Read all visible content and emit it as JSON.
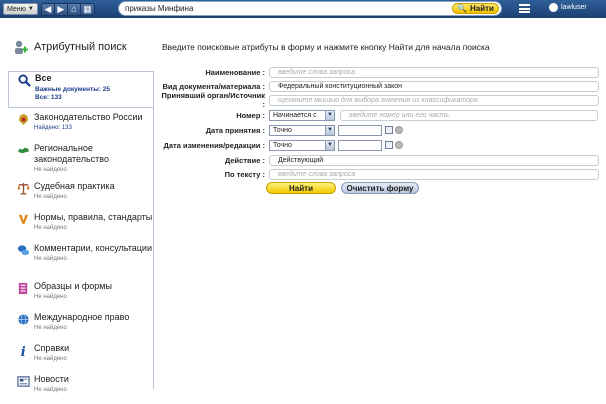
{
  "topbar": {
    "menu_label": "Меню",
    "search_value": "приказы Минфина",
    "search_button": "Найти",
    "username": "lawluser"
  },
  "sidebar": {
    "title": "Атрибутный поиск",
    "items": [
      {
        "label": "Все",
        "sub": "Важные документы: 25",
        "sub2": "Все: 133",
        "icon": "magnifier-icon"
      },
      {
        "label": "Законодательство России",
        "sub": "Найдено: 133",
        "icon": "russia-emblem-icon"
      },
      {
        "label": "Региональное законодательство",
        "sub": "Не найдено",
        "icon": "russia-map-icon"
      },
      {
        "label": "Судебная практика",
        "sub": "Не найдено",
        "icon": "scales-icon"
      },
      {
        "label": "Нормы, правила, стандарты",
        "sub": "Не найдено",
        "icon": "standards-icon"
      },
      {
        "label": "Комментарии, консультации",
        "sub": "Не найдено",
        "icon": "comments-icon"
      },
      {
        "label": "Образцы и формы",
        "sub": "Не найдено",
        "icon": "forms-icon"
      },
      {
        "label": "Международное право",
        "sub": "Не найдено",
        "icon": "globe-icon"
      },
      {
        "label": "Справки",
        "sub": "Не найдено",
        "icon": "info-icon"
      },
      {
        "label": "Новости",
        "sub": "Не найдено",
        "icon": "news-icon"
      }
    ]
  },
  "main": {
    "intro": "Введите поисковые атрибуты в форму и нажмите кнопку Найти для начала поиска",
    "fields": {
      "name_label": "Наименование :",
      "name_placeholder": "введите слова запроса",
      "doctype_label": "Вид документа/материала :",
      "doctype_value": "Федеральный конституционный закон",
      "authority_label": "Принявший орган/Источник :",
      "authority_placeholder": "щелкните мышью для выбора значения из классификатора",
      "number_label": "Номер :",
      "number_mode": "Начинается с",
      "number_placeholder": "введите номер или его часть",
      "date_label": "Дата принятия :",
      "date_mode": "Точно",
      "change_label": "Дата изменения/редакции :",
      "change_mode": "Точно",
      "status_label": "Действие :",
      "status_value": "Действующий",
      "text_label": "По тексту :",
      "text_placeholder": "введите слова запроса"
    },
    "find_button": "Найти",
    "clear_button": "Очистить форму"
  },
  "colors": {
    "topbar": "#2a5088",
    "find": "#f2c900",
    "accent_blue": "#1a3a8a"
  }
}
